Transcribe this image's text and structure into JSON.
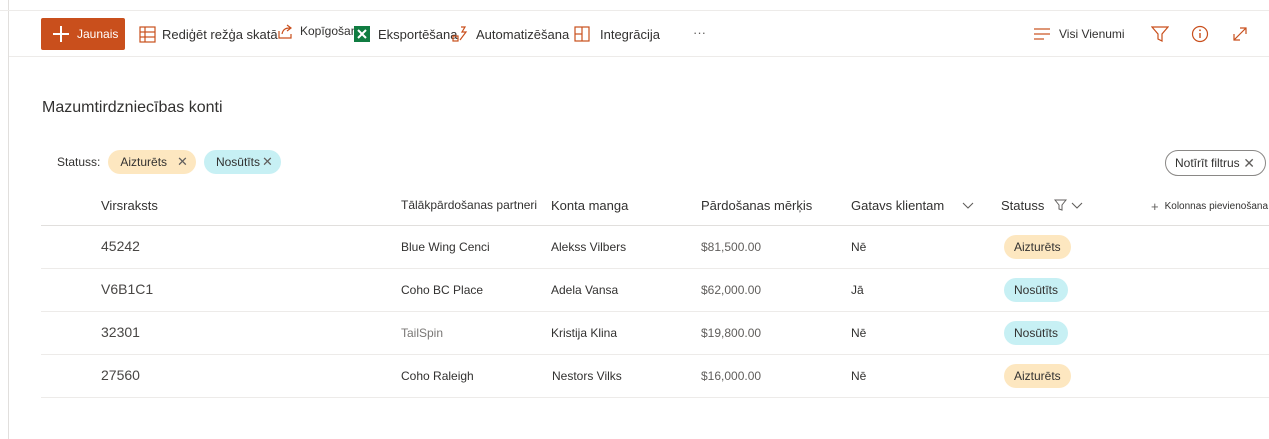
{
  "command_bar": {
    "new_label": "Jaunais",
    "edit_grid_label": "Rediģēt režģa skatā",
    "share_label": "Kopīgošana",
    "export_label": "Eksportēšana",
    "automate_label": "Automatizēšana",
    "integrate_label": "Integrācija",
    "more_label": "···",
    "view_label": "Visi Vienumi"
  },
  "list": {
    "title": "Mazumtirdzniecības konti"
  },
  "filters": {
    "label": "Statuss:",
    "pills": [
      "Aizturēts",
      "Nosūtīts"
    ],
    "clear_label": "Notīrīt filtrus"
  },
  "columns": {
    "title": "Virsraksts",
    "partner": "Tālākpārdošanas partneri",
    "manager": "Konta manga",
    "target": "Pārdošanas mērķis",
    "ready": "Gatavs klientam",
    "status": "Statuss",
    "add": "Kolonnas pievienošana"
  },
  "rows": [
    {
      "title": "45242",
      "partner": "Blue Wing Cenci",
      "manager": "Alekss Vilbers",
      "target": "$81,500.00",
      "ready": "Nē",
      "status": "Aizturēts"
    },
    {
      "title": "V6B1C1",
      "partner": "Coho BC Place",
      "manager": "Adela Vansa",
      "target": "$62,000.00",
      "ready": "Jā",
      "status": "Nosūtīts"
    },
    {
      "title": "32301",
      "partner": "TailSpin",
      "manager": "Kristija Klina",
      "target": "$19,800.00",
      "ready": "Nē",
      "status": "Nosūtīts"
    },
    {
      "title": "27560",
      "partner": "Coho Raleigh",
      "manager": "Nestors Vilks",
      "target": "$16,000.00",
      "ready": "Nē",
      "status": "Aizturēts"
    }
  ],
  "colors": {
    "accent": "#c94f1c",
    "status_held": "#fde7c0",
    "status_sent": "#c7f0f4"
  }
}
